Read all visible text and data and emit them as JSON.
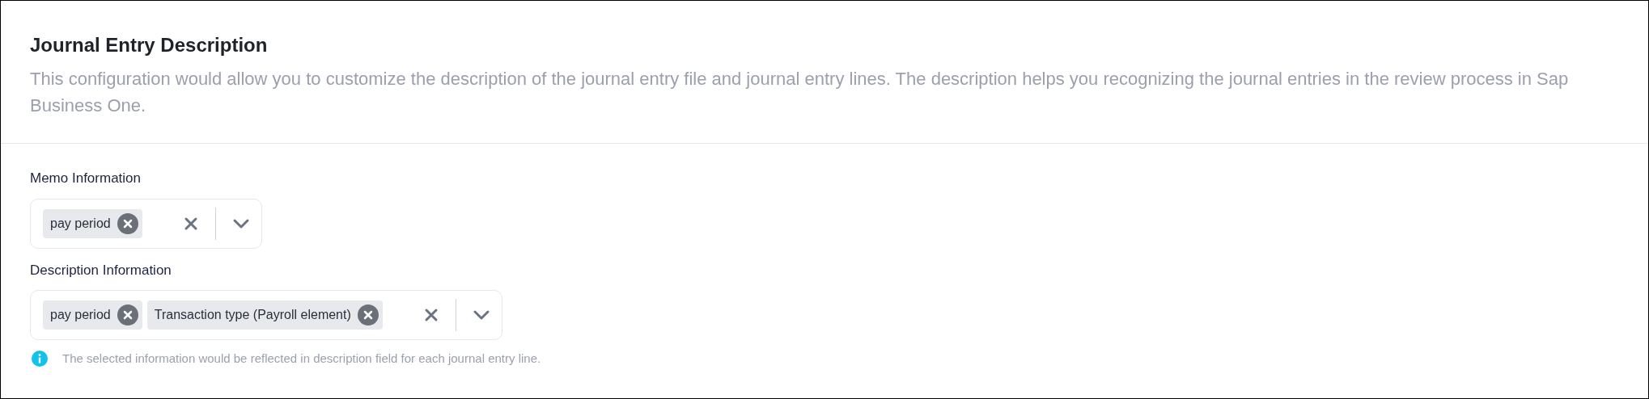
{
  "header": {
    "title": "Journal Entry Description",
    "description": "This configuration would allow you to customize the description of the journal entry file and journal entry lines. The description helps you recognizing the journal entries in the review process in Sap Business One."
  },
  "fields": [
    {
      "label": "Memo Information",
      "tags": [
        "pay period"
      ]
    },
    {
      "label": "Description Information",
      "tags": [
        "pay period",
        "Transaction type (Payroll element)"
      ]
    }
  ],
  "note": "The selected information would be reflected in description field for each journal entry line."
}
